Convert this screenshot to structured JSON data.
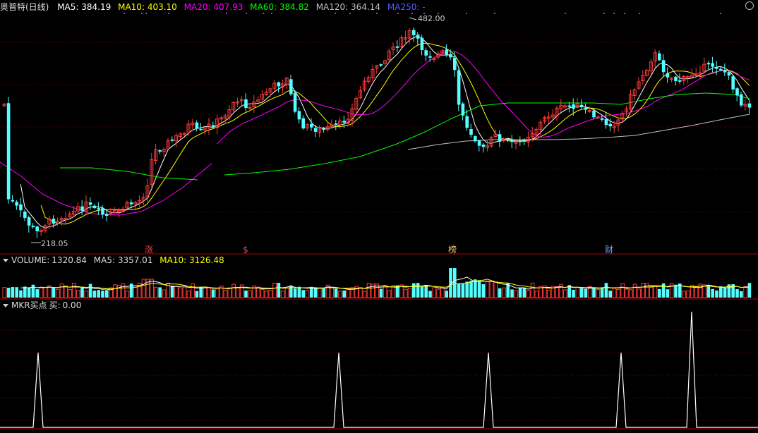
{
  "price_panel": {
    "title": "奥普特(日线)",
    "ma5_label": "MA5:",
    "ma5_value": "384.19",
    "ma10_label": "MA10:",
    "ma10_value": "403.10",
    "ma20_label": "MA20:",
    "ma20_value": "407.93",
    "ma60_label": "MA60:",
    "ma60_value": "384.82",
    "ma120_label": "MA120:",
    "ma120_value": "364.14",
    "ma250_label": "MA250:",
    "ma250_value": "-",
    "high_label": "482.00",
    "low_label": "218.05",
    "markers": [
      "涨",
      "$",
      "榜",
      "财"
    ]
  },
  "volume_panel": {
    "title": "VOLUME:",
    "value": "1320.84",
    "ma5_label": "MA5:",
    "ma5_value": "3357.01",
    "ma10_label": "MA10:",
    "ma10_value": "3126.48"
  },
  "mkr_panel": {
    "title": "MKR买点",
    "buy_label": "买:",
    "buy_value": "0.00"
  },
  "colors": {
    "up": "#ff3b3b",
    "down": "#54ffff",
    "ma5": "#ffffff",
    "ma10": "#ffff00",
    "ma20": "#ff00ff",
    "ma60": "#00ff00",
    "ma120": "#c0c0c0",
    "ma250": "#4a5cff",
    "grid": "#8a0000",
    "separator": "#b00000"
  },
  "chart_data": {
    "type": "candlestick",
    "price_extremes": {
      "high": 482.0,
      "low": 218.05
    },
    "moving_averages": [
      "MA5",
      "MA10",
      "MA20",
      "MA60",
      "MA120",
      "MA250"
    ],
    "mkr_signal_peaks": 5
  }
}
